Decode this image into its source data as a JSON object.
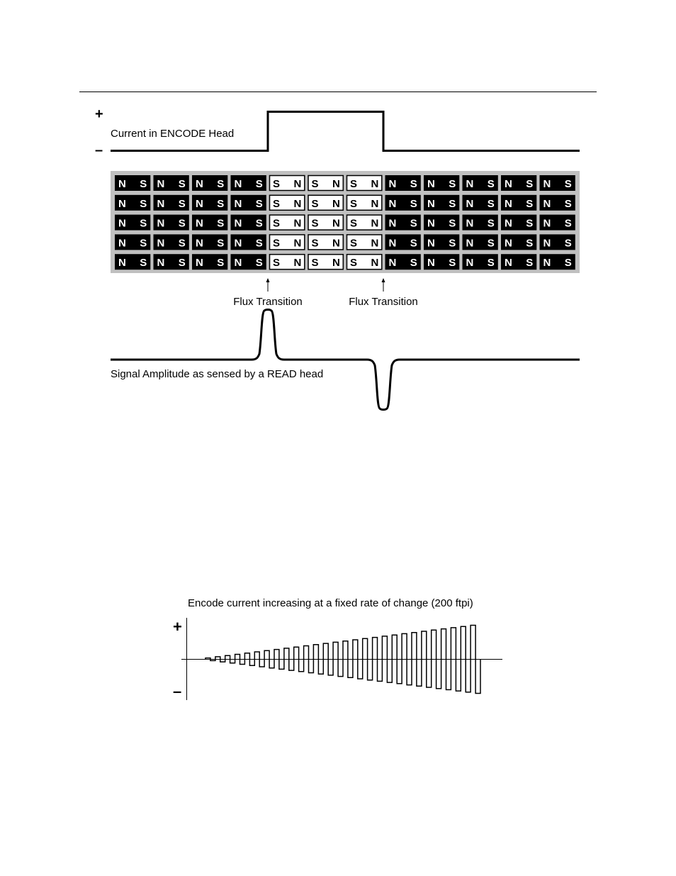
{
  "figure1": {
    "encode_plus_symbol": "+",
    "encode_minus_symbol": "–",
    "encode_label": "Current in ENCODE Head",
    "magnet_rows": 5,
    "magnet_cells": [
      {
        "left": "N",
        "right": "S",
        "polarity": "normal"
      },
      {
        "left": "N",
        "right": "S",
        "polarity": "normal"
      },
      {
        "left": "N",
        "right": "S",
        "polarity": "normal"
      },
      {
        "left": "N",
        "right": "S",
        "polarity": "normal"
      },
      {
        "left": "S",
        "right": "N",
        "polarity": "reversed"
      },
      {
        "left": "S",
        "right": "N",
        "polarity": "reversed"
      },
      {
        "left": "S",
        "right": "N",
        "polarity": "reversed"
      },
      {
        "left": "N",
        "right": "S",
        "polarity": "normal"
      },
      {
        "left": "N",
        "right": "S",
        "polarity": "normal"
      },
      {
        "left": "N",
        "right": "S",
        "polarity": "normal"
      },
      {
        "left": "N",
        "right": "S",
        "polarity": "normal"
      },
      {
        "left": "N",
        "right": "S",
        "polarity": "normal"
      }
    ],
    "flux_labels": [
      "Flux Transition",
      "Flux Transition"
    ],
    "read_label": "Signal Amplitude as sensed by a READ head",
    "colors": {
      "magnet_normal_bg": "#000000",
      "magnet_reversed_bg": "#ffffff",
      "strip_bg": "#c0c0c0"
    }
  },
  "figure2": {
    "title": "Encode current increasing at a fixed rate of change (200 ftpi)",
    "plus_symbol": "+",
    "minus_symbol": "–",
    "cycles": 28,
    "amplitude_start_fraction": 0.04,
    "amplitude_end_fraction": 1.0
  }
}
